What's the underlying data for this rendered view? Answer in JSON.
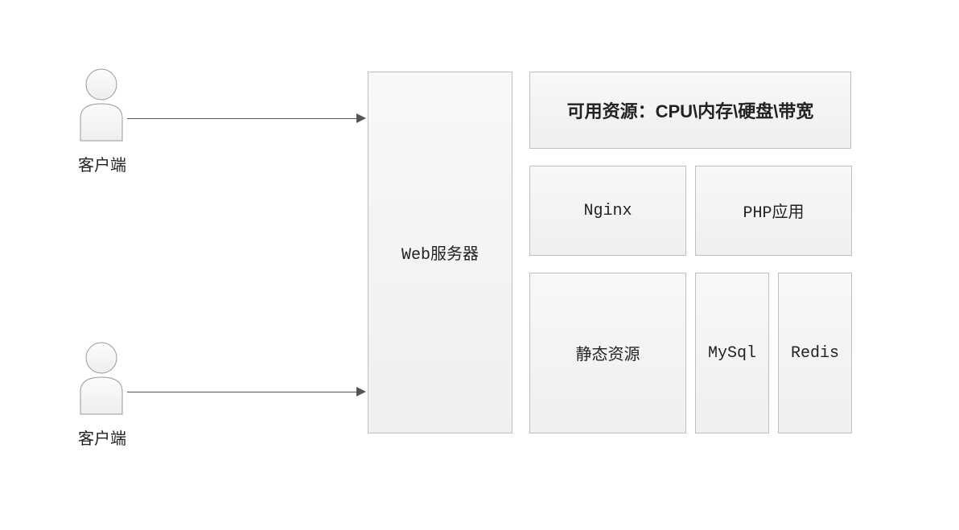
{
  "clients": {
    "label1": "客户端",
    "label2": "客户端"
  },
  "webServer": {
    "label": "Web服务器"
  },
  "resources": {
    "label": "可用资源：CPU\\内存\\硬盘\\带宽"
  },
  "row2": {
    "nginx": "Nginx",
    "php": "PHP应用"
  },
  "row3": {
    "static": "静态资源",
    "mysql": "MySql",
    "redis": "Redis"
  }
}
